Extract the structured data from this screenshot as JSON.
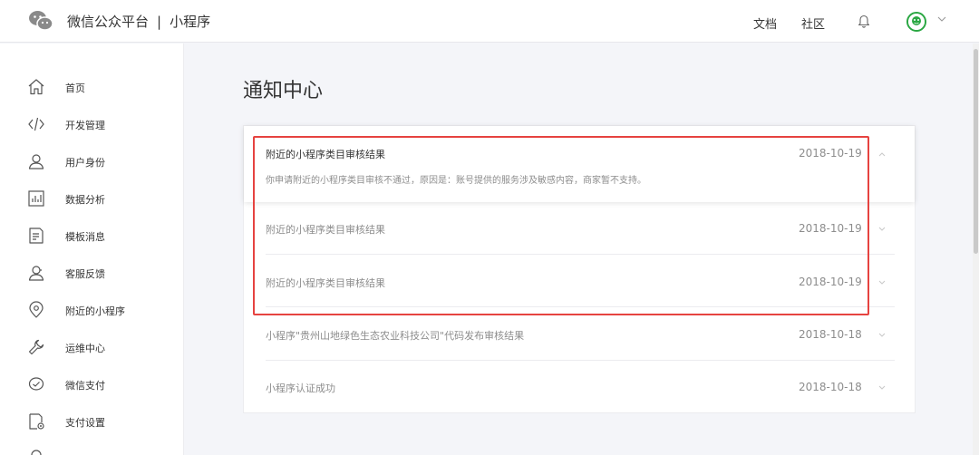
{
  "header": {
    "brand_name": "微信公众平台",
    "brand_separator": "|",
    "brand_sub": "小程序",
    "links": [
      {
        "label": "文档"
      },
      {
        "label": "社区"
      }
    ]
  },
  "sidebar": {
    "items": [
      {
        "label": "首页",
        "icon": "home-icon"
      },
      {
        "label": "开发管理",
        "icon": "code-icon"
      },
      {
        "label": "用户身份",
        "icon": "user-icon"
      },
      {
        "label": "数据分析",
        "icon": "chart-icon"
      },
      {
        "label": "模板消息",
        "icon": "document-icon"
      },
      {
        "label": "客服反馈",
        "icon": "headset-icon"
      },
      {
        "label": "附近的小程序",
        "icon": "location-icon"
      },
      {
        "label": "运维中心",
        "icon": "wrench-icon"
      },
      {
        "label": "微信支付",
        "icon": "wechat-pay-icon"
      },
      {
        "label": "支付设置",
        "icon": "payment-settings-icon"
      }
    ]
  },
  "main": {
    "title": "通知中心",
    "notices": [
      {
        "title": "附近的小程序类目审核结果",
        "date": "2018-10-19",
        "description": "你申请附近的小程序类目审核不通过，原因是：账号提供的服务涉及敏感内容，商家暂不支持。"
      },
      {
        "title": "附近的小程序类目审核结果",
        "date": "2018-10-19"
      },
      {
        "title": "附近的小程序类目审核结果",
        "date": "2018-10-19"
      },
      {
        "title": "小程序\"贵州山地绿色生态农业科技公司\"代码发布审核结果",
        "date": "2018-10-18"
      },
      {
        "title": "小程序认证成功",
        "date": "2018-10-18"
      }
    ]
  },
  "colors": {
    "highlight": "#e64340",
    "accent_green": "#2aa743",
    "text_muted": "#8d8d8d"
  }
}
